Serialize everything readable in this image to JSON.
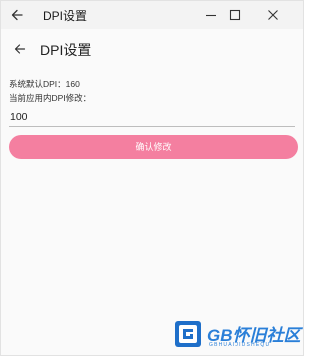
{
  "window": {
    "title": "DPI设置"
  },
  "page": {
    "title": "DPI设置",
    "default_dpi_text": "系统默认DPI：160",
    "current_dpi_label": "当前应用内DPI修改："
  },
  "input": {
    "value": "100"
  },
  "button": {
    "confirm_label": "确认修改"
  },
  "watermark": {
    "brand": "GB怀旧社区",
    "subtitle": "GBHUAIJIUSHEQU"
  },
  "colors": {
    "accent": "#f47fa0",
    "watermark_blue": "#2a7fd8"
  },
  "icons": {
    "titlebar_back": "arrow-left-icon",
    "minimize": "minimize-icon",
    "maximize": "maximize-icon",
    "close": "close-icon",
    "app_back": "arrow-left-icon"
  }
}
